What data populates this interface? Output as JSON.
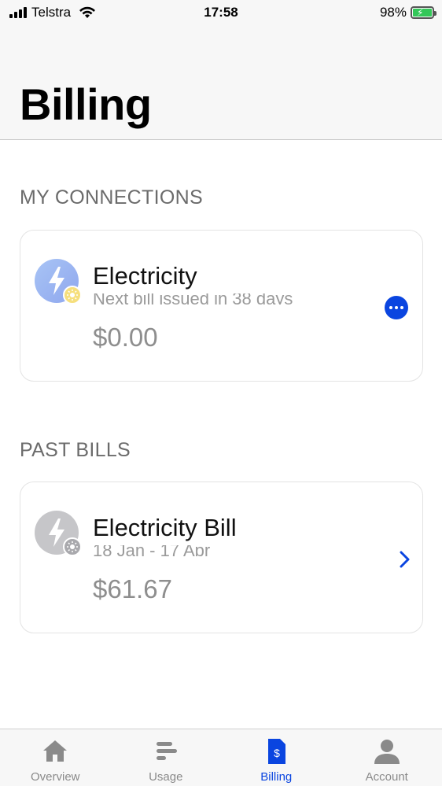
{
  "status_bar": {
    "carrier": "Telstra",
    "time": "17:58",
    "battery": "98%"
  },
  "header": {
    "title": "Billing"
  },
  "sections": {
    "connections_heading": "MY CONNECTIONS",
    "past_bills_heading": "PAST BILLS"
  },
  "connection_card": {
    "title": "Electricity",
    "subtitle": "Next bill issued in 38 days",
    "amount": "$0.00",
    "icon": "lightning-bolt-icon",
    "action_icon": "more-ellipsis-icon"
  },
  "past_bill_card": {
    "title": "Electricity Bill",
    "subtitle": "18 Jan - 17 Apr",
    "amount": "$61.67",
    "icon": "lightning-bolt-icon",
    "action_icon": "chevron-right-icon"
  },
  "tabs": [
    {
      "label": "Overview",
      "icon": "home-icon",
      "active": false
    },
    {
      "label": "Usage",
      "icon": "usage-bars-icon",
      "active": false
    },
    {
      "label": "Billing",
      "icon": "bill-dollar-icon",
      "active": true
    },
    {
      "label": "Account",
      "icon": "person-icon",
      "active": false
    }
  ],
  "colors": {
    "accent": "#0a45e0",
    "battery": "#34c759",
    "muted_text": "#8e8e8e"
  }
}
